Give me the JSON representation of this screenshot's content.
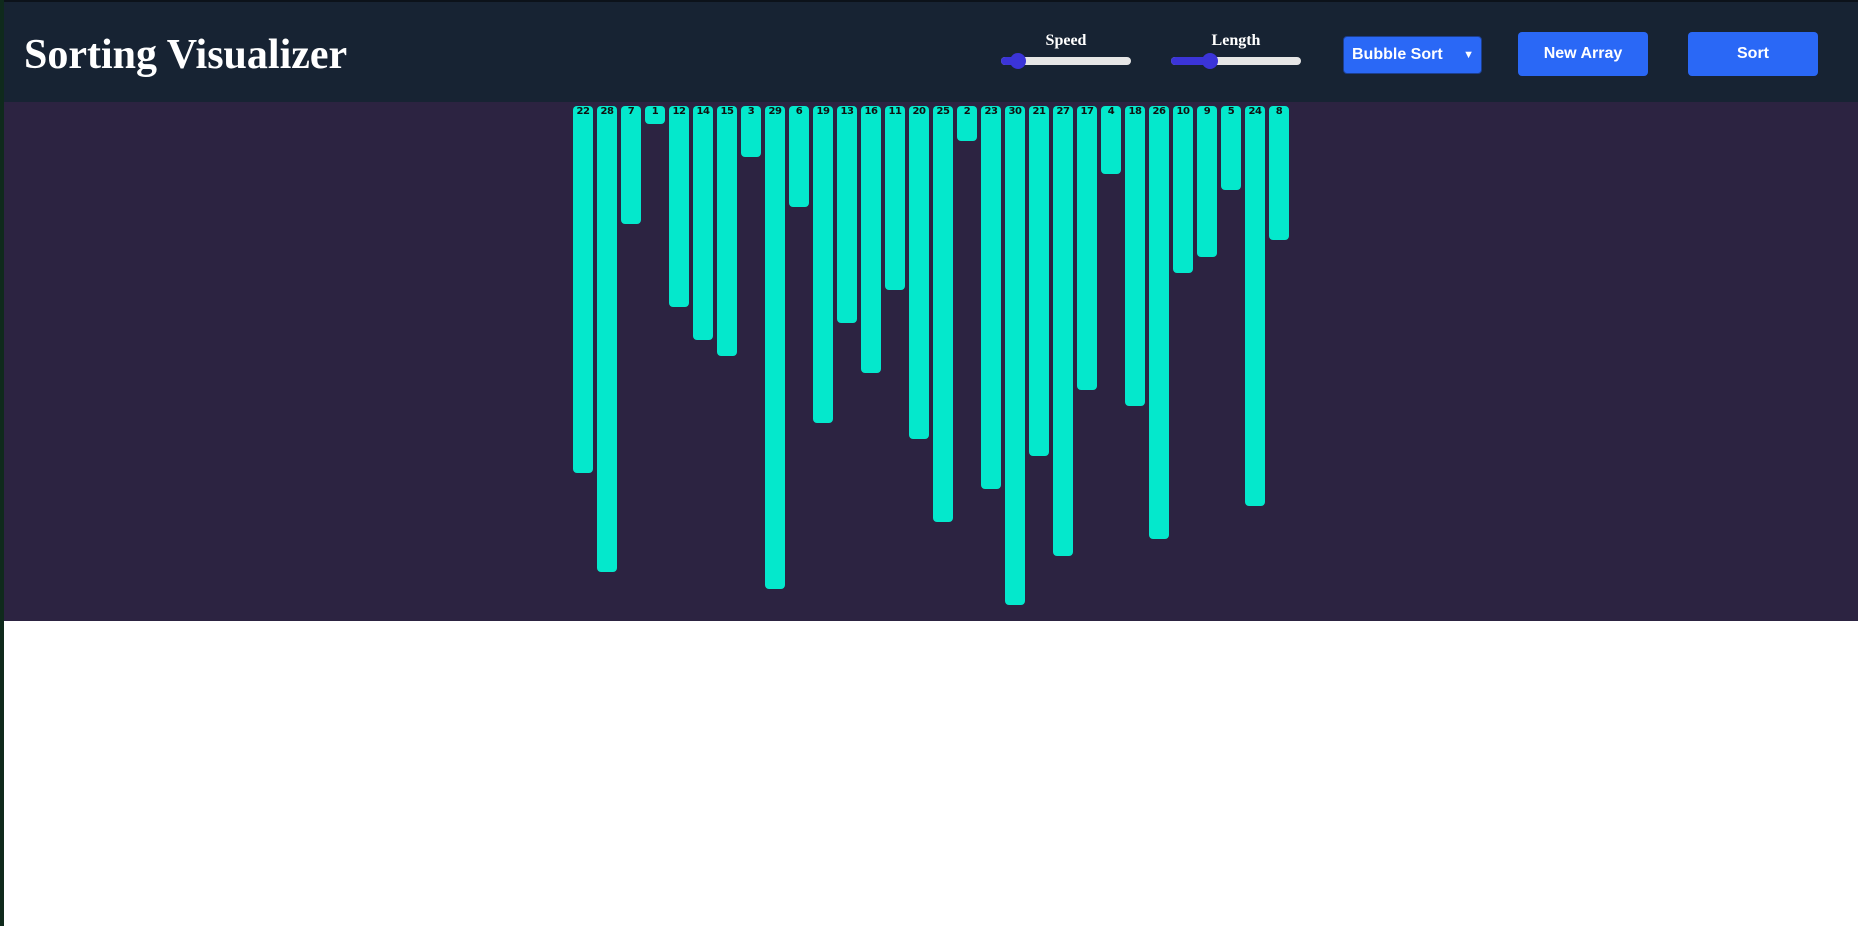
{
  "header": {
    "title": "Sorting Visualizer"
  },
  "controls": {
    "speed": {
      "label": "Speed",
      "level": 0.13
    },
    "length": {
      "label": "Length",
      "level": 0.3
    },
    "algorithm": {
      "selected": "Bubble Sort"
    },
    "new_array_label": "New Array",
    "sort_label": "Sort"
  },
  "array": {
    "values": [
      "22",
      "28",
      "7",
      "1",
      "12",
      "14",
      "15",
      "3",
      "29",
      "6",
      "19",
      "13",
      "16",
      "11",
      "20",
      "25",
      "2",
      "23",
      "30",
      "21",
      "27",
      "17",
      "4",
      "18",
      "26",
      "10",
      "9",
      "5",
      "24",
      "8"
    ],
    "bar_color": "#04e8cc"
  },
  "colors": {
    "header_bg": "#172333",
    "stage_bg": "#2c2341",
    "button_bg": "#2a68f6",
    "slider_accent": "#3b34d8"
  }
}
